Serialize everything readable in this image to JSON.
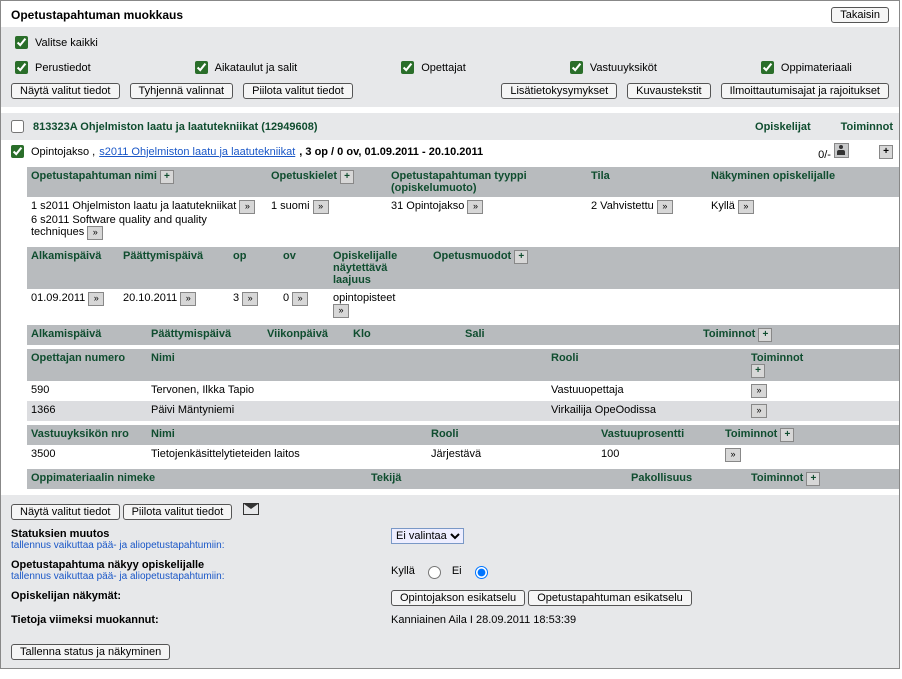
{
  "header": {
    "title": "Opetustapahtuman muokkaus",
    "back": "Takaisin"
  },
  "filters": {
    "select_all": "Valitse kaikki",
    "opts": {
      "perustiedot": "Perustiedot",
      "aikataulut": "Aikataulut ja salit",
      "opettajat": "Opettajat",
      "vastuuyksikot": "Vastuuyksiköt",
      "oppimateriaali": "Oppimateriaali"
    },
    "buttons": {
      "nayta": "Näytä valitut tiedot",
      "tyhjenna": "Tyhjennä valinnat",
      "piilota": "Piilota valitut tiedot",
      "lisatieto": "Lisätietokysymykset",
      "kuvaus": "Kuvaustekstit",
      "ilmo": "Ilmoittautumisajat ja rajoitukset"
    }
  },
  "course": {
    "title": "813323A Ohjelmiston laatu ja laatutekniikat (12949608)",
    "opiskelijat_label": "Opiskelijat",
    "toiminnot_label": "Toiminnot",
    "sub_prefix": "Opintojakso ,",
    "sub_link": "s2011 Ohjelmiston laatu ja laatutekniikat",
    "sub_rest": ", 3 op / 0 ov, 01.09.2011 - 20.10.2011",
    "opiskelijat_value": "0/-"
  },
  "perustiedot": {
    "headers": {
      "nimi": "Opetustapahtuman nimi",
      "kielet": "Opetuskielet",
      "tyyppi": "Opetustapahtuman tyyppi (opiskelumuoto)",
      "tila": "Tila",
      "nakyminen": "Näkyminen opiskelijalle"
    },
    "rows": [
      {
        "nimi": "1 s2011 Ohjelmiston laatu ja laatutekniikat",
        "kielet": "1 suomi",
        "tyyppi": "31 Opintojakso",
        "tila": "2 Vahvistettu",
        "nakyminen": "Kyllä"
      },
      {
        "nimi": "6 s2011 Software quality and quality techniques",
        "kielet": "",
        "tyyppi": "",
        "tila": "",
        "nakyminen": ""
      }
    ]
  },
  "ajat": {
    "headers": {
      "alkamis": "Alkamispäivä",
      "paattymis": "Päättymispäivä",
      "op": "op",
      "ov": "ov",
      "laajuus": "Opiskelijalle näytettävä laajuus",
      "muodot": "Opetusmuodot"
    },
    "row": {
      "alkamis": "01.09.2011",
      "paattymis": "20.10.2011",
      "op": "3",
      "ov": "0",
      "laajuus": "opintopisteet"
    }
  },
  "aikataulu": {
    "headers": {
      "alkamis": "Alkamispäivä",
      "paattymis": "Päättymispäivä",
      "viikko": "Viikonpäivä",
      "klo": "Klo",
      "sali": "Sali",
      "toiminnot": "Toiminnot"
    }
  },
  "opettajat": {
    "headers": {
      "num": "Opettajan numero",
      "nimi": "Nimi",
      "rooli": "Rooli",
      "toiminnot": "Toiminnot"
    },
    "rows": [
      {
        "num": "590",
        "nimi": "Tervonen, Ilkka Tapio",
        "rooli": "Vastuuopettaja"
      },
      {
        "num": "1366",
        "nimi": "Päivi Mäntyniemi",
        "rooli": "Virkailija OpeOodissa"
      }
    ]
  },
  "vastuu": {
    "headers": {
      "nro": "Vastuuyksikön nro",
      "nimi": "Nimi",
      "rooli": "Rooli",
      "prosentti": "Vastuuprosentti",
      "toiminnot": "Toiminnot"
    },
    "rows": [
      {
        "nro": "3500",
        "nimi": "Tietojenkäsittelytieteiden laitos",
        "rooli": "Järjestävä",
        "prosentti": "100"
      }
    ]
  },
  "oppimateriaali": {
    "headers": {
      "nimeke": "Oppimateriaalin nimeke",
      "tekija": "Tekijä",
      "pakollisuus": "Pakollisuus",
      "toiminnot": "Toiminnot"
    }
  },
  "bottom": {
    "nayta": "Näytä valitut tiedot",
    "piilota": "Piilota valitut tiedot",
    "status_label": "Statuksien muutos",
    "status_sub": "tallennus vaikuttaa pää- ja aliopetustapahtumiin:",
    "status_select": "Ei valintaa",
    "nakyy_label": "Opetustapahtuma näkyy opiskelijalle",
    "nakyy_sub": "tallennus vaikuttaa pää- ja aliopetustapahtumiin:",
    "kylla": "Kyllä",
    "ei": "Ei",
    "nakymat_label": "Opiskelijan näkymät:",
    "esikatselu1": "Opintojakson esikatselu",
    "esikatselu2": "Opetustapahtuman esikatselu",
    "viimeksi_label": "Tietoja viimeksi muokannut:",
    "viimeksi_value": "Kanniainen Aila I 28.09.2011 18:53:39",
    "tallenna": "Tallenna status ja näkyminen"
  }
}
